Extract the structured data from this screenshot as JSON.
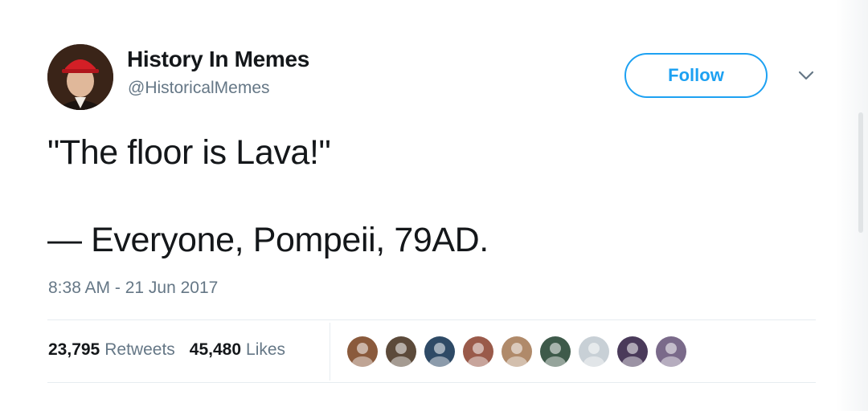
{
  "account": {
    "display_name": "History In Memes",
    "handle": "@HistoricalMemes",
    "avatar_icon": "portrait-with-red-cap-avatar"
  },
  "follow": {
    "label": "Follow",
    "color": "#1da1f2"
  },
  "menu": {
    "icon": "chevron-down-icon"
  },
  "tweet": {
    "line1": "\"The floor is Lava!\"",
    "line2": "— Everyone, Pompeii, 79AD.",
    "timestamp": "8:38 AM - 21 Jun 2017"
  },
  "stats": {
    "retweets_count": "23,795",
    "retweets_label": "Retweets",
    "likes_count": "45,480",
    "likes_label": "Likes"
  },
  "likers": [
    {
      "name": "liker-avatar-1",
      "color": "#8a5a3c"
    },
    {
      "name": "liker-avatar-2",
      "color": "#5c4a3a"
    },
    {
      "name": "liker-avatar-3",
      "color": "#2e4a66"
    },
    {
      "name": "liker-avatar-4",
      "color": "#9a5a4a"
    },
    {
      "name": "liker-avatar-5",
      "color": "#b08a6a"
    },
    {
      "name": "liker-avatar-6",
      "color": "#3e5a4a"
    },
    {
      "name": "liker-avatar-7",
      "color": "#c8d0d6"
    },
    {
      "name": "liker-avatar-8",
      "color": "#4a3a5a"
    },
    {
      "name": "liker-avatar-9",
      "color": "#7a6a8a"
    }
  ]
}
